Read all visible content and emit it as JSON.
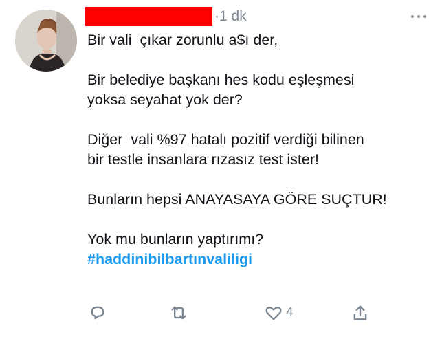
{
  "tweet": {
    "author_name_redacted": "",
    "timestamp": "1 dk",
    "paragraphs": [
      "Bir vali  çıkar zorunlu a$ı der,",
      "Bir belediye başkanı hes kodu eşleşmesi\nyoksa seyahat yok der?",
      "Diğer  vali %97 hatalı pozitif verdiği bilinen\nbir testle insanlara rızasız test ister!",
      "Bunların hepsi ANAYASAYA GÖRE SUÇTUR!",
      "Yok mu bunların yaptırımı?"
    ],
    "hashtag": "#haddinibilbartınvaliligi",
    "like_count": "4",
    "separator": "·"
  },
  "icons": {
    "more": "more-dots-icon",
    "reply": "reply-icon",
    "retweet": "retweet-icon",
    "like": "heart-icon",
    "share": "share-icon"
  },
  "colors": {
    "redaction": "#ff0000",
    "hashtag": "#1d9bf0",
    "muted": "#7a8691",
    "text": "#111418"
  }
}
